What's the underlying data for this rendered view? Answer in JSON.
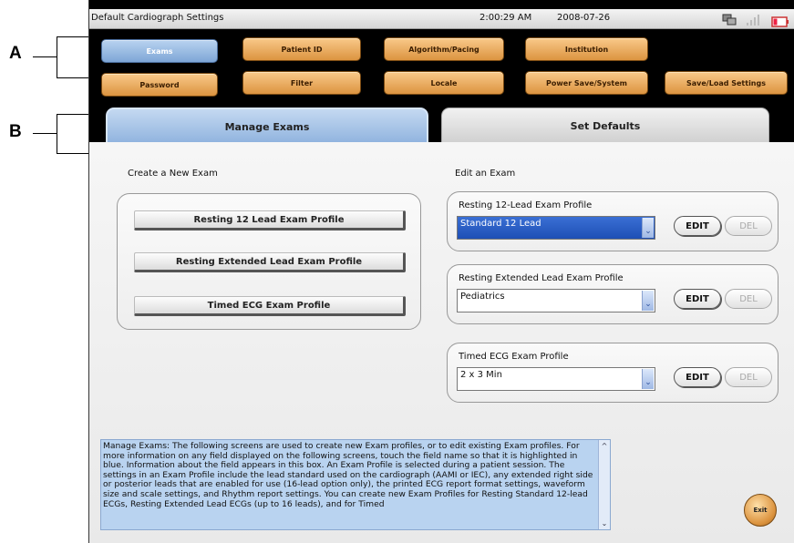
{
  "callouts": {
    "a": "A",
    "b": "B"
  },
  "titlebar": {
    "title": "Default Cardiograph Settings",
    "time": "2:00:29 AM",
    "date": "2008-07-26"
  },
  "menu": {
    "row1": [
      "Exams",
      "Patient ID",
      "Algorithm/Pacing",
      "Institution"
    ],
    "row2": [
      "Password",
      "Filter",
      "Locale",
      "Power Save/System",
      "Save/Load Settings"
    ],
    "active": "Exams"
  },
  "tabs": {
    "manage": "Manage Exams",
    "defaults": "Set Defaults"
  },
  "create": {
    "heading": "Create a New Exam",
    "buttons": [
      "Resting 12 Lead Exam Profile",
      "Resting Extended Lead Exam Profile",
      "Timed ECG Exam Profile"
    ]
  },
  "edit": {
    "heading": "Edit an Exam",
    "groups": [
      {
        "label": "Resting 12-Lead Exam Profile",
        "value": "Standard 12 Lead",
        "edit": "EDIT",
        "del": "DEL"
      },
      {
        "label": "Resting Extended Lead Exam Profile",
        "value": "Pediatrics",
        "edit": "EDIT",
        "del": "DEL"
      },
      {
        "label": "Timed ECG Exam Profile",
        "value": "2 x 3 Min",
        "edit": "EDIT",
        "del": "DEL"
      }
    ]
  },
  "help": {
    "text": "Manage Exams: The following screens are used to create new Exam profiles, or to edit existing Exam profiles. For more information on any field displayed on the following screens, touch the field name so that it is highlighted in blue. Information about the field appears in this box. An Exam Profile is selected during a patient session. The settings in an Exam Profile include the lead standard used on the cardiograph (AAMI or IEC), any extended right side or posterior leads that are enabled for use (16-lead option only), the printed ECG report format settings, waveform size and scale settings, and Rhythm report settings. You can create new Exam Profiles for Resting Standard 12-lead ECGs, Resting Extended Lead ECGs (up to 16 leads), and for Timed"
  },
  "exit": "Exit",
  "colors": {
    "accent_orange": "#dc9440",
    "active_blue": "#7ea6d6",
    "select_blue": "#1e4fb5",
    "help_bg": "#b9d3f0"
  }
}
